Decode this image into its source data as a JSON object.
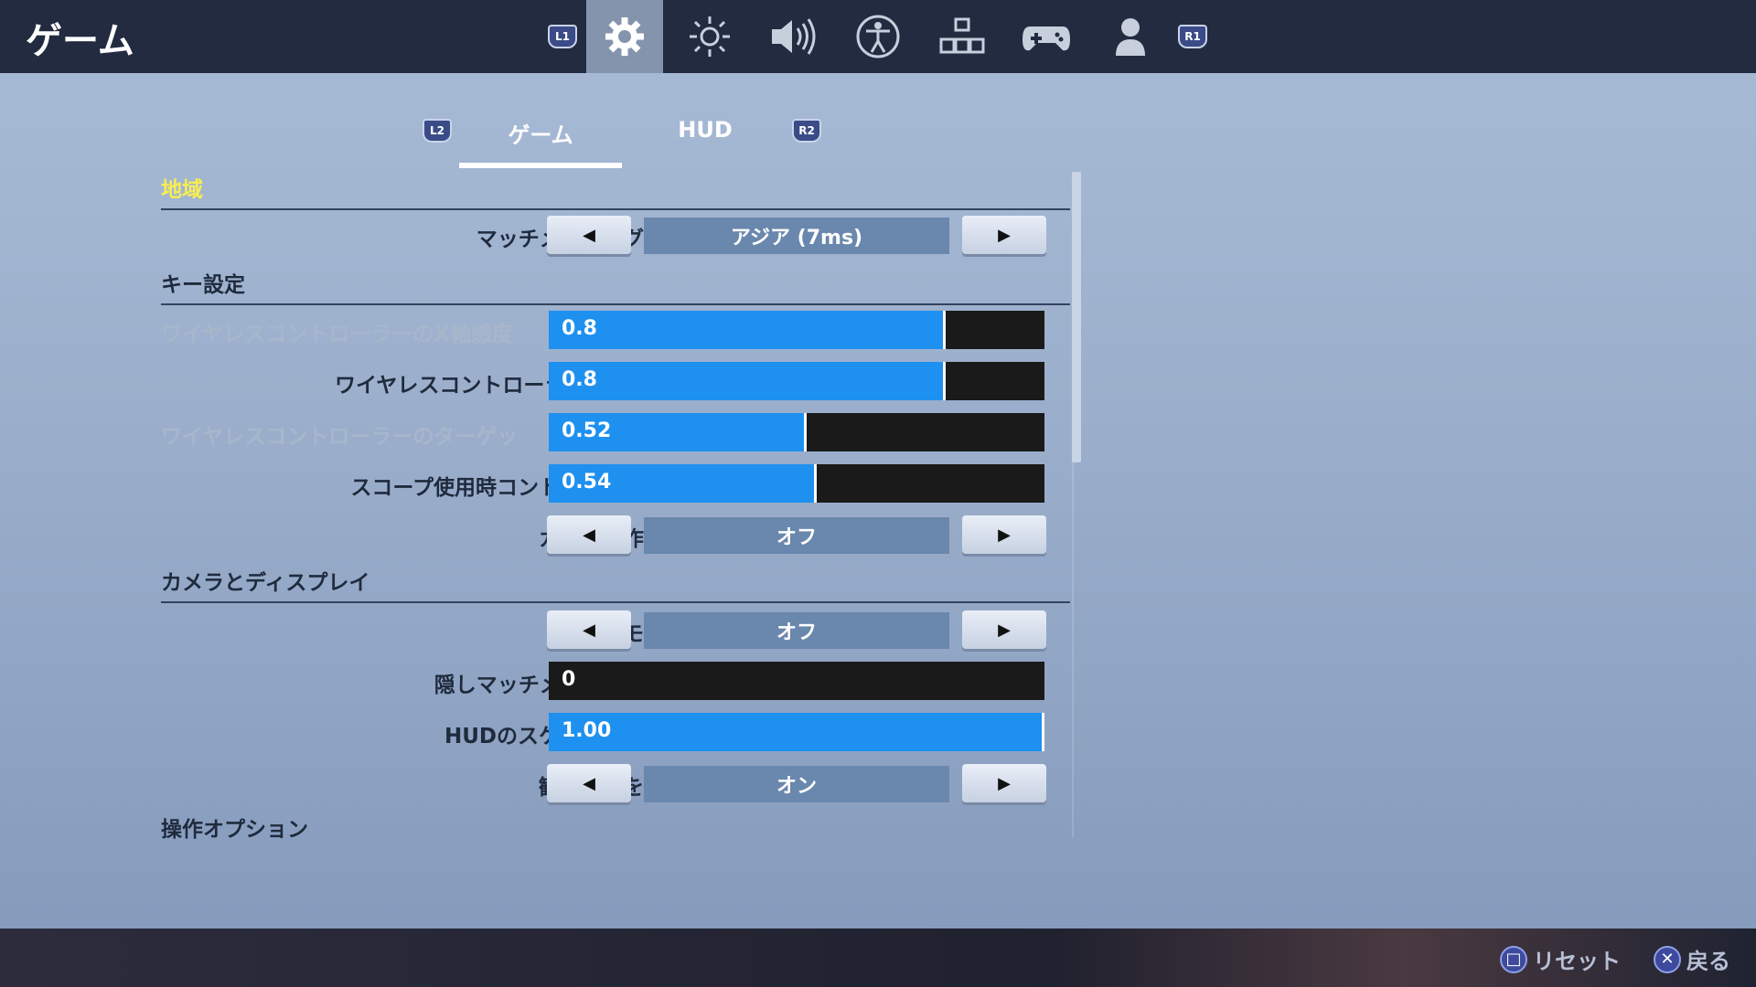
{
  "header": {
    "title": "ゲーム",
    "icons": [
      {
        "name": "l1-button-icon",
        "label": "L1"
      },
      {
        "name": "gear-icon",
        "label": "",
        "active": true
      },
      {
        "name": "brightness-icon",
        "label": ""
      },
      {
        "name": "speaker-icon",
        "label": ""
      },
      {
        "name": "accessibility-icon",
        "label": ""
      },
      {
        "name": "input-icon",
        "label": ""
      },
      {
        "name": "gamepad-icon",
        "label": ""
      },
      {
        "name": "account-icon",
        "label": ""
      },
      {
        "name": "r1-button-icon",
        "label": "R1"
      }
    ]
  },
  "subtabs": {
    "left_shoulder": "L2",
    "right_shoulder": "R2",
    "tabs": [
      {
        "label": "ゲーム",
        "active": true
      },
      {
        "label": "HUD",
        "active": false
      }
    ]
  },
  "sections": {
    "region": "地域",
    "keys": "キー設定",
    "camera": "カメラとディスプレイ",
    "controls": "操作オプション"
  },
  "settings": {
    "matchmaking_region": {
      "label": "マッチメイキング地域",
      "value": "アジア (7ms)"
    },
    "x_sensitivity": {
      "label": "ワイヤレスコントローラーのX軸感度",
      "value": "0.8",
      "fill": 0.8
    },
    "y_sensitivity": {
      "label": "ワイヤレスコントローラーのY軸感度",
      "value": "0.8",
      "fill": 0.8
    },
    "target_sensitivity": {
      "label": "ワイヤレスコントローラーのターゲッ",
      "value": "0.52",
      "fill": 0.52
    },
    "scope_sensitivity": {
      "label": "スコープ使用時コントローラー感度",
      "value": "0.54",
      "fill": 0.54
    },
    "invert_camera": {
      "label": "カメラ操作反転",
      "value": "オフ"
    },
    "streamer_mode": {
      "label": "配信者モード",
      "value": "オフ"
    },
    "hidden_delay": {
      "label": "隠しマッチメイキング遅延",
      "value": "0",
      "fill": 0
    },
    "hud_scale": {
      "label": "HUDのスケールを設定。",
      "value": "1.00",
      "fill": 1.0
    },
    "spectator_count": {
      "label": "観戦者数を表示",
      "value": "オン"
    }
  },
  "arrows": {
    "left": "◀",
    "right": "▶"
  },
  "footer": {
    "reset_icon": "□",
    "reset_label": "リセット",
    "back_icon": "✕",
    "back_label": "戻る"
  },
  "colors": {
    "accent_blue": "#1e90f0",
    "section_highlight": "#f6ee51",
    "topbar": "#222b40"
  }
}
